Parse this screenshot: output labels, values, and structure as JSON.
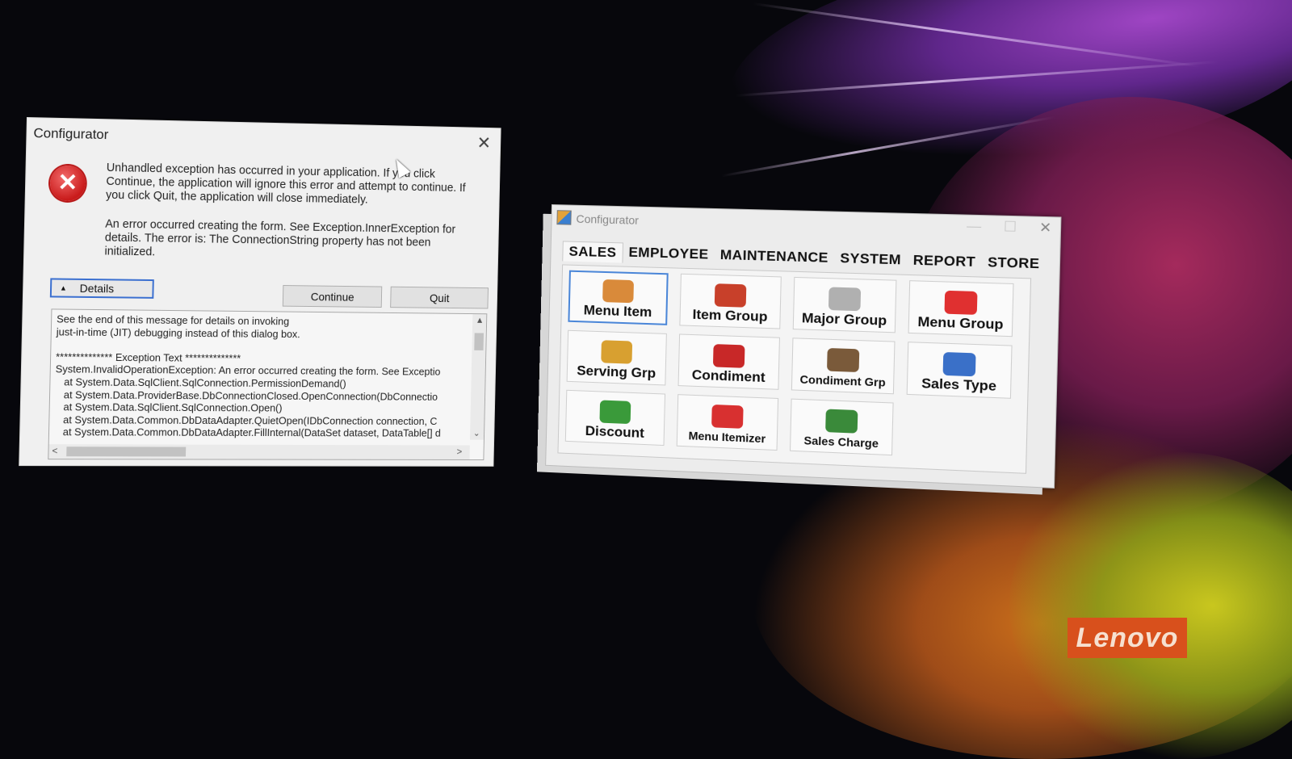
{
  "dialog": {
    "title": "Configurator",
    "close_glyph": "✕",
    "error_icon": "error-x-icon",
    "message": "Unhandled exception has occurred in your application. If you click Continue, the application will ignore this error and attempt to continue. If you click Quit, the application will close immediately.",
    "error_detail": "An error occurred creating the form. See Exception.InnerException for details.  The error is: The ConnectionString property has not been initialized.",
    "details_label": "Details",
    "details_arrow": "▲",
    "continue_label": "Continue",
    "quit_label": "Quit",
    "details_text": "See the end of this message for details on invoking\njust-in-time (JIT) debugging instead of this dialog box.\n\n************** Exception Text **************\nSystem.InvalidOperationException: An error occurred creating the form. See Exceptio\n   at System.Data.SqlClient.SqlConnection.PermissionDemand()\n   at System.Data.ProviderBase.DbConnectionClosed.OpenConnection(DbConnectio\n   at System.Data.SqlClient.SqlConnection.Open()\n   at System.Data.Common.DbDataAdapter.QuietOpen(IDbConnection connection, C\n   at System.Data.Common.DbDataAdapter.FillInternal(DataSet dataset, DataTable[] d",
    "scroll_up": "▲",
    "scroll_down": "⌄",
    "scroll_left": "<",
    "scroll_right": ">"
  },
  "configurator": {
    "title": "Configurator",
    "minimize_glyph": "—",
    "maximize_glyph": "☐",
    "close_glyph": "✕",
    "tabs": [
      "SALES",
      "EMPLOYEE",
      "MAINTENANCE",
      "SYSTEM",
      "REPORT",
      "STORE"
    ],
    "active_tab": "SALES",
    "tiles": [
      {
        "label": "Menu Item",
        "icon": "menu-item-icon",
        "color": "#d98a3a"
      },
      {
        "label": "Item Group",
        "icon": "item-group-icon",
        "color": "#c8402a"
      },
      {
        "label": "Major Group",
        "icon": "major-group-icon",
        "color": "#b0b0b0"
      },
      {
        "label": "Menu Group",
        "icon": "menu-group-icon",
        "color": "#e03030"
      },
      {
        "label": "Serving Grp",
        "icon": "serving-grp-icon",
        "color": "#d8a030"
      },
      {
        "label": "Condiment",
        "icon": "condiment-icon",
        "color": "#c82828"
      },
      {
        "label": "Condiment Grp",
        "icon": "condiment-grp-icon",
        "color": "#7a5a3a"
      },
      {
        "label": "Sales Type",
        "icon": "sales-type-icon",
        "color": "#3a70c8"
      },
      {
        "label": "Discount",
        "icon": "discount-icon",
        "color": "#3a9a3a"
      },
      {
        "label": "Menu Itemizer",
        "icon": "menu-itemizer-icon",
        "color": "#d83030"
      },
      {
        "label": "Sales Charge",
        "icon": "sales-charge-icon",
        "color": "#3a8a3a"
      }
    ]
  },
  "brand": "Lenovo",
  "colors": {
    "accent": "#3a6fd0",
    "error": "#c91b1b",
    "brand": "#d8501c"
  }
}
